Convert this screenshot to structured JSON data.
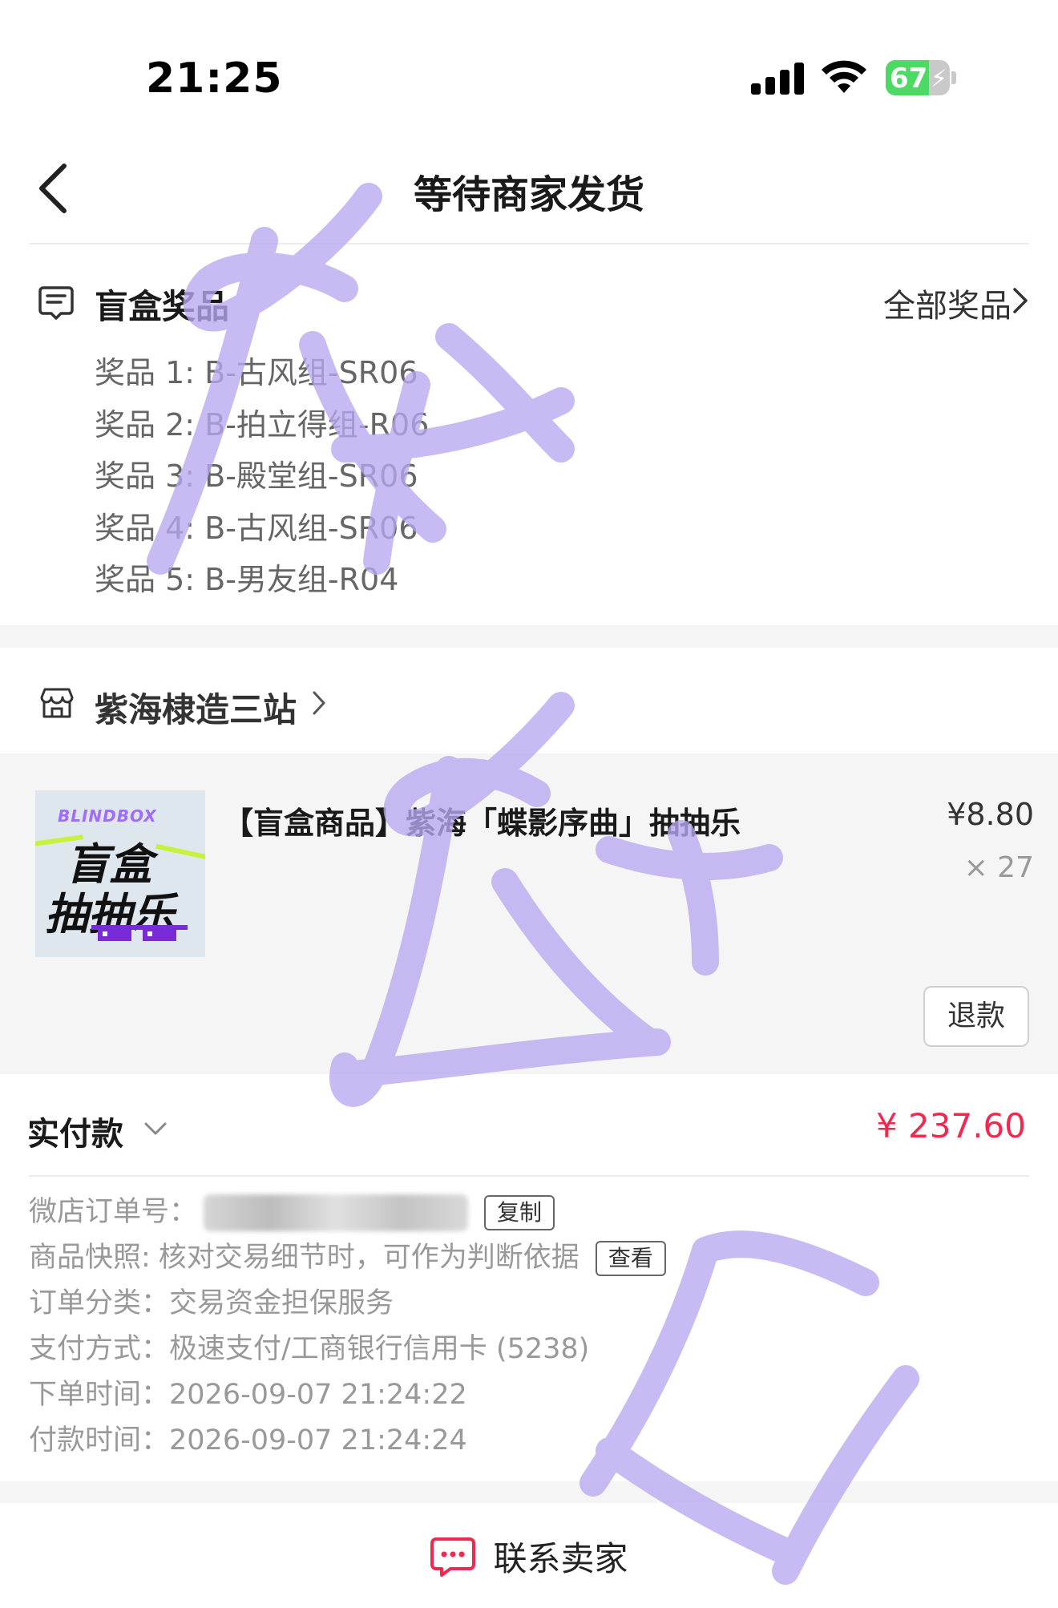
{
  "status_bar": {
    "time": "21:25",
    "battery": "67",
    "battery_level": 0.67,
    "signal_icon": "cellular-signal-icon",
    "wifi_icon": "wifi-icon",
    "battery_color": "#4cd964"
  },
  "header": {
    "title": "等待商家发货",
    "back_icon": "chevron-left-icon"
  },
  "prize_section": {
    "title": "盲盒奖品",
    "icon": "receipt-chat-icon",
    "all_prizes_label": "全部奖品",
    "items": [
      "奖品 1: B-古风组-SR06",
      "奖品 2: B-拍立得组-R06",
      "奖品 3: B-殿堂组-SR06",
      "奖品 4: B-古风组-SR06",
      "奖品 5: B-男友组-R04"
    ]
  },
  "shop": {
    "name": "紫海棣造三站",
    "icon": "storefront-icon"
  },
  "product": {
    "thumb_brand": "BLINDBOX",
    "thumb_line1": "盲盒",
    "thumb_line2": "抽抽乐",
    "name": "【盲盒商品】紫海「蝶影序曲」抽抽乐",
    "price": "¥8.80",
    "quantity": "× 27",
    "refund_label": "退款"
  },
  "payment": {
    "label": "实付款",
    "amount": "¥ 237.60",
    "amount_color": "#f2284e"
  },
  "order_info": {
    "order_no_label": "微店订单号：",
    "copy_label": "复制",
    "snapshot_label": "商品快照:",
    "snapshot_value": "核对交易细节时，可作为判断依据",
    "view_label": "查看",
    "category_label": "订单分类：",
    "category_value": "交易资金担保服务",
    "pay_method_label": "支付方式：",
    "pay_method_value": "极速支付/工商银行信用卡 (5238)",
    "order_time_label": "下单时间：",
    "order_time_value": "2026-09-07 21:24:22",
    "pay_time_label": "付款时间：",
    "pay_time_value": "2026-09-07 21:24:24"
  },
  "bottom": {
    "contact_label": "联系卖家",
    "contact_icon": "chat-bubble-icon",
    "accent_color": "#f2284e"
  },
  "watermark_color": "#b9a8f0"
}
